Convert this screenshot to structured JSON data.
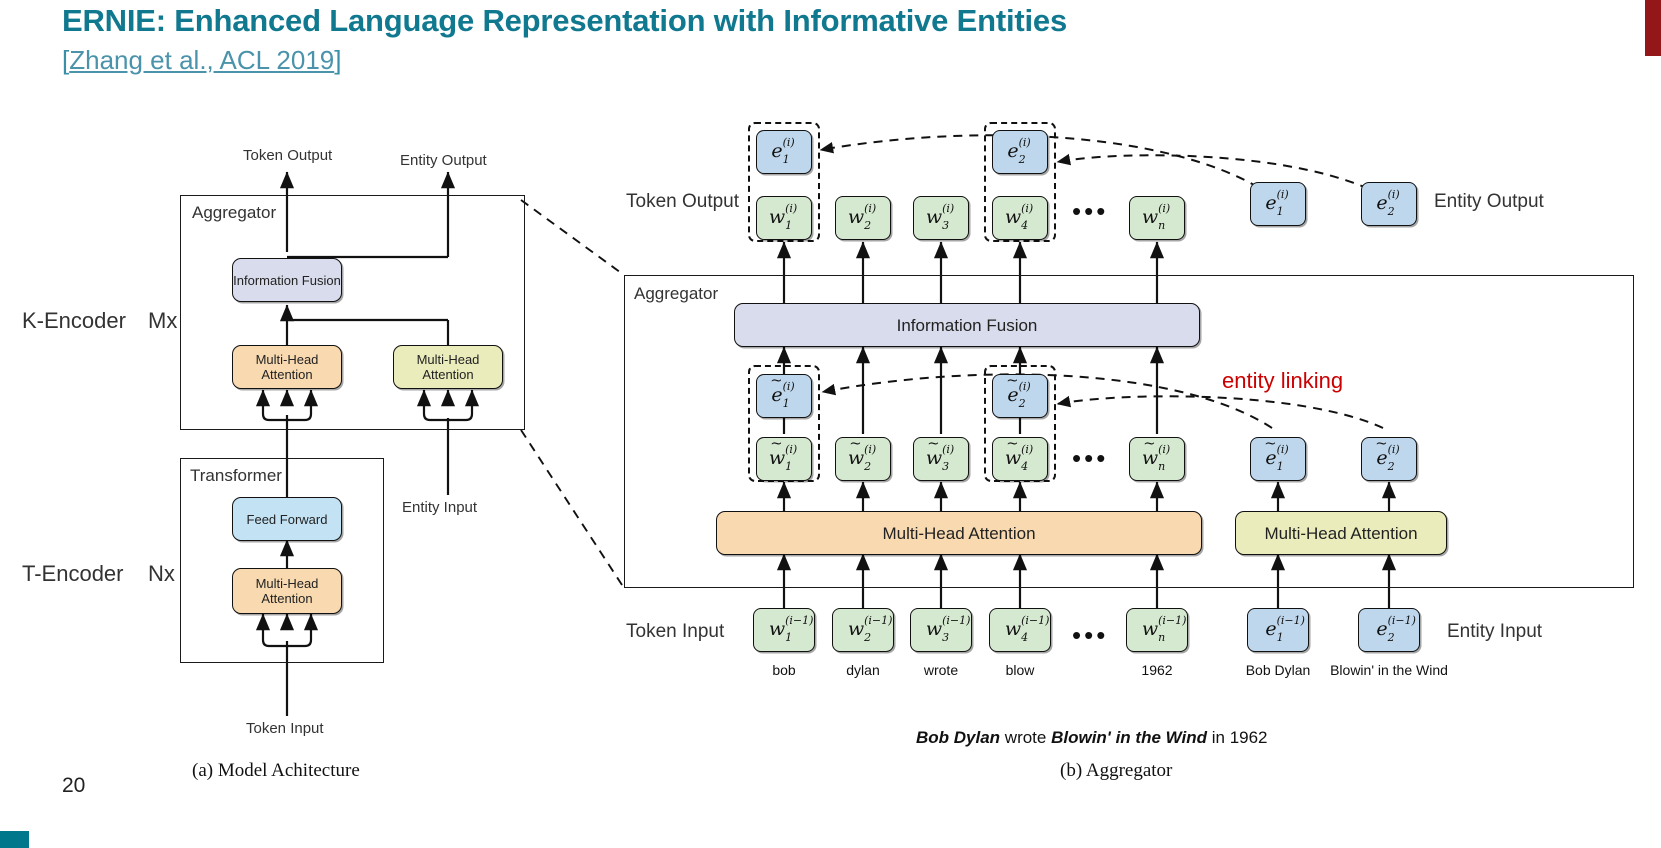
{
  "slide": {
    "title": "ERNIE: Enhanced Language Representation with Informative Entities",
    "subtitle_prefix": "[",
    "subtitle_link": "Zhang et al., ACL 2019",
    "subtitle_suffix": "]",
    "page_number": "20",
    "accent_color_top_right": "#931618",
    "accent_color_bottom_left": "#00778b",
    "title_color": "#10788f",
    "link_color": "#4a93ab"
  },
  "figure_a": {
    "caption": "(a) Model Achitecture",
    "labels": {
      "token_output": "Token Output",
      "entity_output": "Entity Output",
      "entity_input": "Entity Input",
      "token_input": "Token Input",
      "k_encoder": "K-Encoder",
      "k_encoder_count": "Mx",
      "t_encoder": "T-Encoder",
      "t_encoder_count": "Nx",
      "aggregator": "Aggregator",
      "transformer": "Transformer"
    },
    "blocks": {
      "information_fusion": "Information Fusion",
      "multi_head_attention_token": "Multi-Head Attention",
      "multi_head_attention_entity": "Multi-Head Attention",
      "feed_forward": "Feed Forward",
      "multi_head_attention_transformer": "Multi-Head Attention"
    },
    "colors": {
      "information_fusion": "#d9dcec",
      "multi_head_attention_token": "#f8d9b0",
      "multi_head_attention_entity": "#eaecbb",
      "feed_forward": "#c3e3f5"
    }
  },
  "figure_b": {
    "caption": "(b) Aggregator",
    "labels": {
      "token_output": "Token Output",
      "entity_output": "Entity Output",
      "token_input": "Token Input",
      "entity_input": "Entity Input",
      "aggregator": "Aggregator",
      "entity_linking": "entity linking",
      "entity_linking_color": "#cc0000"
    },
    "blocks": {
      "information_fusion": "Information Fusion",
      "multi_head_attention_token": "Multi-Head Attention",
      "multi_head_attention_entity": "Multi-Head Attention"
    },
    "sentence": {
      "part1": "Bob Dylan",
      "part2": " wrote ",
      "part3": "Blowin' in the Wind",
      "part4": " in 1962"
    },
    "output_tokens": [
      {
        "base": "w",
        "sub": "1",
        "sup": "(i)",
        "tilde": false
      },
      {
        "base": "w",
        "sub": "2",
        "sup": "(i)",
        "tilde": false
      },
      {
        "base": "w",
        "sub": "3",
        "sup": "(i)",
        "tilde": false
      },
      {
        "base": "w",
        "sub": "4",
        "sup": "(i)",
        "tilde": false
      },
      {
        "base": "w",
        "sub": "n",
        "sup": "(i)",
        "tilde": false
      }
    ],
    "output_entities_stacked": [
      {
        "base": "e",
        "sub": "1",
        "sup": "(i)",
        "tilde": false
      },
      {
        "base": "e",
        "sub": "2",
        "sup": "(i)",
        "tilde": false
      }
    ],
    "output_entities_right": [
      {
        "base": "e",
        "sub": "1",
        "sup": "(i)",
        "tilde": false
      },
      {
        "base": "e",
        "sub": "2",
        "sup": "(i)",
        "tilde": false
      }
    ],
    "mid_tokens": [
      {
        "base": "w",
        "sub": "1",
        "sup": "(i)",
        "tilde": true
      },
      {
        "base": "w",
        "sub": "2",
        "sup": "(i)",
        "tilde": true
      },
      {
        "base": "w",
        "sub": "3",
        "sup": "(i)",
        "tilde": true
      },
      {
        "base": "w",
        "sub": "4",
        "sup": "(i)",
        "tilde": true
      },
      {
        "base": "w",
        "sub": "n",
        "sup": "(i)",
        "tilde": true
      }
    ],
    "mid_entities_stacked": [
      {
        "base": "e",
        "sub": "1",
        "sup": "(i)",
        "tilde": true
      },
      {
        "base": "e",
        "sub": "2",
        "sup": "(i)",
        "tilde": true
      }
    ],
    "mid_entities_right": [
      {
        "base": "e",
        "sub": "1",
        "sup": "(i)",
        "tilde": true
      },
      {
        "base": "e",
        "sub": "2",
        "sup": "(i)",
        "tilde": true
      }
    ],
    "input_tokens": [
      {
        "base": "w",
        "sub": "1",
        "sup": "(i−1)",
        "tilde": false,
        "word": "bob"
      },
      {
        "base": "w",
        "sub": "2",
        "sup": "(i−1)",
        "tilde": false,
        "word": "dylan"
      },
      {
        "base": "w",
        "sub": "3",
        "sup": "(i−1)",
        "tilde": false,
        "word": "wrote"
      },
      {
        "base": "w",
        "sub": "4",
        "sup": "(i−1)",
        "tilde": false,
        "word": "blow"
      },
      {
        "base": "w",
        "sub": "n",
        "sup": "(i−1)",
        "tilde": false,
        "word": "1962"
      }
    ],
    "input_entities": [
      {
        "base": "e",
        "sub": "1",
        "sup": "(i−1)",
        "tilde": false,
        "word": "Bob Dylan"
      },
      {
        "base": "e",
        "sub": "2",
        "sup": "(i−1)",
        "tilde": false,
        "word": "Blowin' in the Wind"
      }
    ],
    "ellipsis": "•••",
    "colors": {
      "token_box": "#d5e8d0",
      "entity_box": "#bed7ec",
      "information_fusion": "#d9dcec",
      "multi_head_attention_token": "#f8d9b0",
      "multi_head_attention_entity": "#eaecbb"
    }
  }
}
